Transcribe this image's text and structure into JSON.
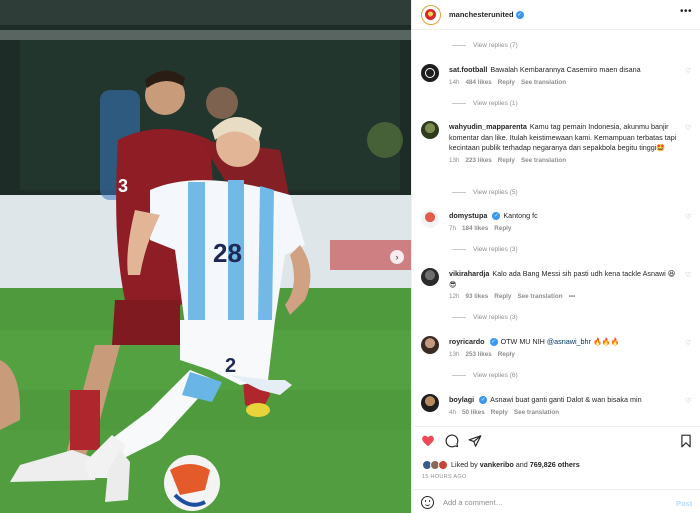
{
  "post": {
    "account": "manchesterunited",
    "photo_jersey_numbers": [
      "3",
      "28",
      "2"
    ]
  },
  "comments": [
    {
      "type": "replies",
      "label": "View replies (7)"
    },
    {
      "type": "comment",
      "user": "sat.football",
      "text": "Bawalah Kembarannya Casemiro maen disana",
      "time": "14h",
      "likes": "484 likes",
      "reply": "Reply",
      "translate": "See translation"
    },
    {
      "type": "replies",
      "label": "View replies (1)"
    },
    {
      "type": "comment",
      "user": "wahyudin_mapparenta",
      "text": "Kamu tag pemain Indonesia, akunmu banjir komentar dan like. Itulah keistimewaan kami. Kemampuan terbatas tapi kecintaan publik terhadap negaranya dan sepakbola begitu tinggi🤩",
      "time": "13h",
      "likes": "223 likes",
      "reply": "Reply",
      "translate": "See translation"
    },
    {
      "type": "replies",
      "label": "View replies (5)"
    },
    {
      "type": "comment",
      "user": "domystupa",
      "text": "Kantong fc",
      "time": "7h",
      "likes": "184 likes",
      "reply": "Reply"
    },
    {
      "type": "replies",
      "label": "View replies (3)"
    },
    {
      "type": "comment",
      "user": "vikirahardja",
      "text": "Kalo ada Bang Messi sih pasti udh kena tackle Asnawi 😆😎",
      "time": "12h",
      "likes": "93 likes",
      "reply": "Reply",
      "translate": "See translation",
      "more": "•••"
    },
    {
      "type": "replies",
      "label": "View replies (3)"
    },
    {
      "type": "comment",
      "user": "royricardo",
      "text": "OTW MU NIH",
      "mention": "@asnawi_bhr",
      "emoji": "🔥🔥🔥",
      "time": "13h",
      "likes": "253 likes",
      "reply": "Reply"
    },
    {
      "type": "replies",
      "label": "View replies (6)"
    },
    {
      "type": "comment",
      "user": "boylagi",
      "text": "Asnawi buat ganti ganti Dalot & wan bisaka min",
      "time": "4h",
      "likes": "50 likes",
      "reply": "Reply",
      "translate": "See translation"
    }
  ],
  "likes": {
    "prefix": "Liked by",
    "user": "vankeribo",
    "and": "and",
    "count": "769,826 others"
  },
  "time_ago": "15 HOURS AGO",
  "comment_box": {
    "placeholder": "Add a comment…",
    "post_label": "Post"
  },
  "colors": {
    "heart": "#ed4956",
    "link": "#00376b",
    "verified": "#3897f0",
    "muted": "#8e8e8e"
  }
}
